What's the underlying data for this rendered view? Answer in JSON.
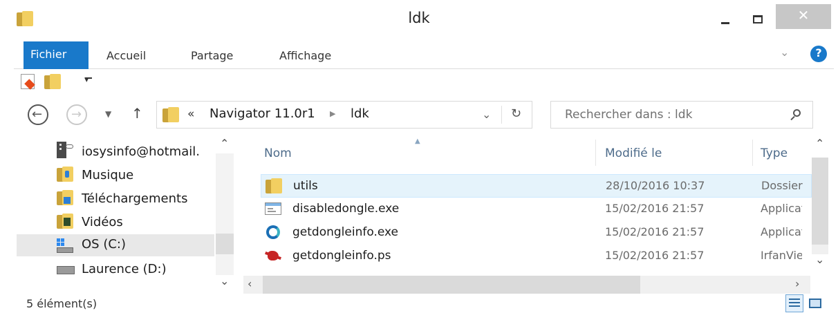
{
  "window": {
    "title": "ldk"
  },
  "ribbon": {
    "tabs": [
      "Fichier",
      "Accueil",
      "Partage",
      "Affichage"
    ]
  },
  "address": {
    "overflow": "«",
    "crumbs": [
      "Navigator 11.0r1",
      "ldk"
    ]
  },
  "search": {
    "placeholder": "Rechercher dans : ldk"
  },
  "nav_tree": [
    {
      "label": "iosysinfo@hotmail.",
      "icon": "onedrive-icon"
    },
    {
      "label": "Musique",
      "icon": "music-folder-icon"
    },
    {
      "label": "Téléchargements",
      "icon": "downloads-folder-icon"
    },
    {
      "label": "Vidéos",
      "icon": "videos-folder-icon"
    },
    {
      "label": "OS (C:)",
      "icon": "system-drive-icon"
    },
    {
      "label": "Laurence (D:)",
      "icon": "drive-icon"
    }
  ],
  "columns": {
    "name": "Nom",
    "modified": "Modifié le",
    "type": "Type"
  },
  "files": [
    {
      "name": "utils",
      "modified": "28/10/2016 10:37",
      "type": "Dossier",
      "icon": "folder-icon"
    },
    {
      "name": "disabledongle.exe",
      "modified": "15/02/2016 21:57",
      "type": "Application",
      "icon": "exe-icon"
    },
    {
      "name": "getdongleinfo.exe",
      "modified": "15/02/2016 21:57",
      "type": "Application",
      "icon": "app-logo-icon"
    },
    {
      "name": "getdongleinfo.ps",
      "modified": "15/02/2016 21:57",
      "type": "IrfanView",
      "icon": "irfanview-icon"
    }
  ],
  "status": {
    "count": "5 élément(s)"
  },
  "colors": {
    "accent": "#1979ca",
    "selection": "#e5f3fb",
    "selection_border": "#cce8ff",
    "close": "#c7c7c7"
  }
}
